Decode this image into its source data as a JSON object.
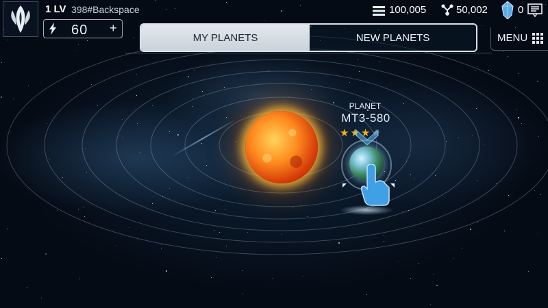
{
  "player": {
    "level": "1 LV",
    "name": "398#Backspace"
  },
  "energy": {
    "value": "60",
    "plus": "+"
  },
  "resources": {
    "credits": "100,005",
    "parts": "50,002",
    "crystals": "0"
  },
  "tabs": [
    {
      "label": "MY PLANETS",
      "active": true
    },
    {
      "label": "NEW PLANETS",
      "active": false
    }
  ],
  "menu": {
    "label": "MENU"
  },
  "planet": {
    "title": "PLANET",
    "code": "MT3-580",
    "stars_filled": 3,
    "stars_total": 4
  },
  "colors": {
    "tab_active_bg": "#d3dbe1",
    "sun_glow": "#ffb43c",
    "star_filled": "#f2b21c",
    "star_empty": "#6b7680",
    "pointer_blue": "#3fa0e6"
  },
  "icons": {
    "emblem": "alien-emblem-icon",
    "energy": "lightning-icon",
    "credits": "stack-icon",
    "parts": "molecule-icon",
    "crystals": "crystal-icon",
    "notifications": "message-icon",
    "menu": "grid-icon",
    "pointer": "hand-pointer-icon"
  }
}
